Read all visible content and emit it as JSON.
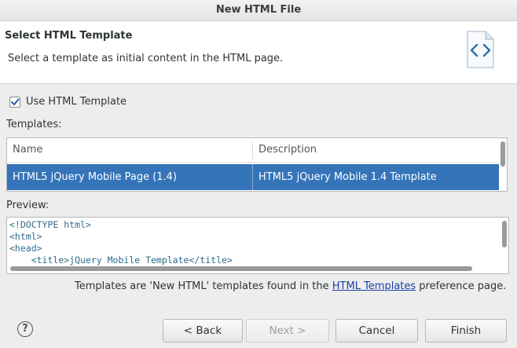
{
  "window": {
    "title": "New HTML File"
  },
  "banner": {
    "title": "Select HTML Template",
    "description": "Select a template as initial content in the HTML page.",
    "icon": "html-file-icon"
  },
  "use_template": {
    "label": "Use HTML Template",
    "checked": true
  },
  "templates": {
    "label": "Templates:",
    "columns": [
      "Name",
      "Description"
    ],
    "rows": [
      {
        "name": "HTML5 jQuery Mobile Page (1.4)",
        "description": "HTML5 jQuery Mobile 1.4 Template",
        "selected": true
      }
    ]
  },
  "preview": {
    "label": "Preview:",
    "lines": [
      "<!DOCTYPE html>",
      "<html>",
      "<head>",
      "    <title>jQuery Mobile Template</title>"
    ]
  },
  "footnote": {
    "before": "Templates are 'New HTML' templates found in the ",
    "link": "HTML Templates",
    "after": " preference page."
  },
  "buttons": {
    "help": "?",
    "back": "< Back",
    "next": "Next >",
    "cancel": "Cancel",
    "finish": "Finish"
  },
  "colors": {
    "selection": "#3574b8",
    "link": "#1a3ea8",
    "tag": "#2e6c8c"
  }
}
